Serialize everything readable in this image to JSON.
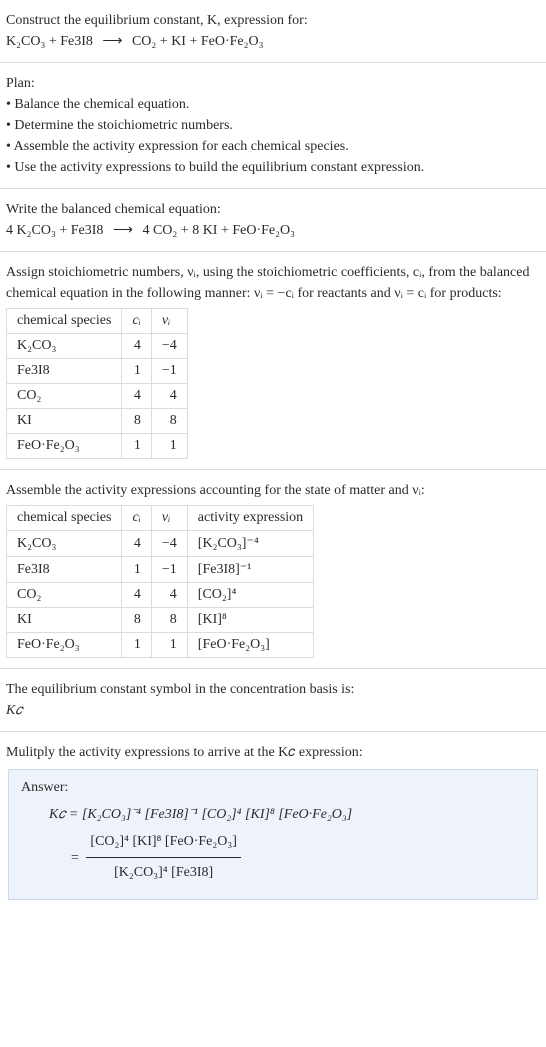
{
  "sec1": {
    "intro": "Construct the equilibrium constant, K, expression for:",
    "eq_lhs": "K₂CO₃ + Fe3I8",
    "eq_rhs": "CO₂ + KI + FeO·Fe₂O₃",
    "arrow": "⟶"
  },
  "sec2": {
    "title": "Plan:",
    "b1": "• Balance the chemical equation.",
    "b2": "• Determine the stoichiometric numbers.",
    "b3": "• Assemble the activity expression for each chemical species.",
    "b4": "• Use the activity expressions to build the equilibrium constant expression."
  },
  "sec3": {
    "title": "Write the balanced chemical equation:",
    "eq_lhs": "4 K₂CO₃ + Fe3I8",
    "eq_rhs": "4 CO₂ + 8 KI + FeO·Fe₂O₃",
    "arrow": "⟶"
  },
  "sec4": {
    "text1": "Assign stoichiometric numbers, νᵢ, using the stoichiometric coefficients, cᵢ, from the balanced chemical equation in the following manner: νᵢ = −cᵢ for reactants and νᵢ = cᵢ for products:",
    "headers": {
      "h1": "chemical species",
      "h2": "cᵢ",
      "h3": "νᵢ"
    },
    "rows": [
      {
        "sp": "K₂CO₃",
        "c": "4",
        "v": "−4"
      },
      {
        "sp": "Fe3I8",
        "c": "1",
        "v": "−1"
      },
      {
        "sp": "CO₂",
        "c": "4",
        "v": "4"
      },
      {
        "sp": "KI",
        "c": "8",
        "v": "8"
      },
      {
        "sp": "FeO·Fe₂O₃",
        "c": "1",
        "v": "1"
      }
    ]
  },
  "sec5": {
    "title": "Assemble the activity expressions accounting for the state of matter and νᵢ:",
    "headers": {
      "h1": "chemical species",
      "h2": "cᵢ",
      "h3": "νᵢ",
      "h4": "activity expression"
    },
    "rows": [
      {
        "sp": "K₂CO₃",
        "c": "4",
        "v": "−4",
        "a": "[K₂CO₃]⁻⁴"
      },
      {
        "sp": "Fe3I8",
        "c": "1",
        "v": "−1",
        "a": "[Fe3I8]⁻¹"
      },
      {
        "sp": "CO₂",
        "c": "4",
        "v": "4",
        "a": "[CO₂]⁴"
      },
      {
        "sp": "KI",
        "c": "8",
        "v": "8",
        "a": "[KI]⁸"
      },
      {
        "sp": "FeO·Fe₂O₃",
        "c": "1",
        "v": "1",
        "a": "[FeO·Fe₂O₃]"
      }
    ]
  },
  "sec6": {
    "line1": "The equilibrium constant symbol in the concentration basis is:",
    "line2": "K𝑐"
  },
  "sec7": {
    "title": "Mulitply the activity expressions to arrive at the K𝑐 expression:"
  },
  "answer": {
    "title": "Answer:",
    "line1": "K𝑐 = [K₂CO₃]⁻⁴ [Fe3I8]⁻¹ [CO₂]⁴ [KI]⁸ [FeO·Fe₂O₃]",
    "eqword": "= ",
    "num": "[CO₂]⁴ [KI]⁸ [FeO·Fe₂O₃]",
    "den": "[K₂CO₃]⁴ [Fe3I8]"
  }
}
